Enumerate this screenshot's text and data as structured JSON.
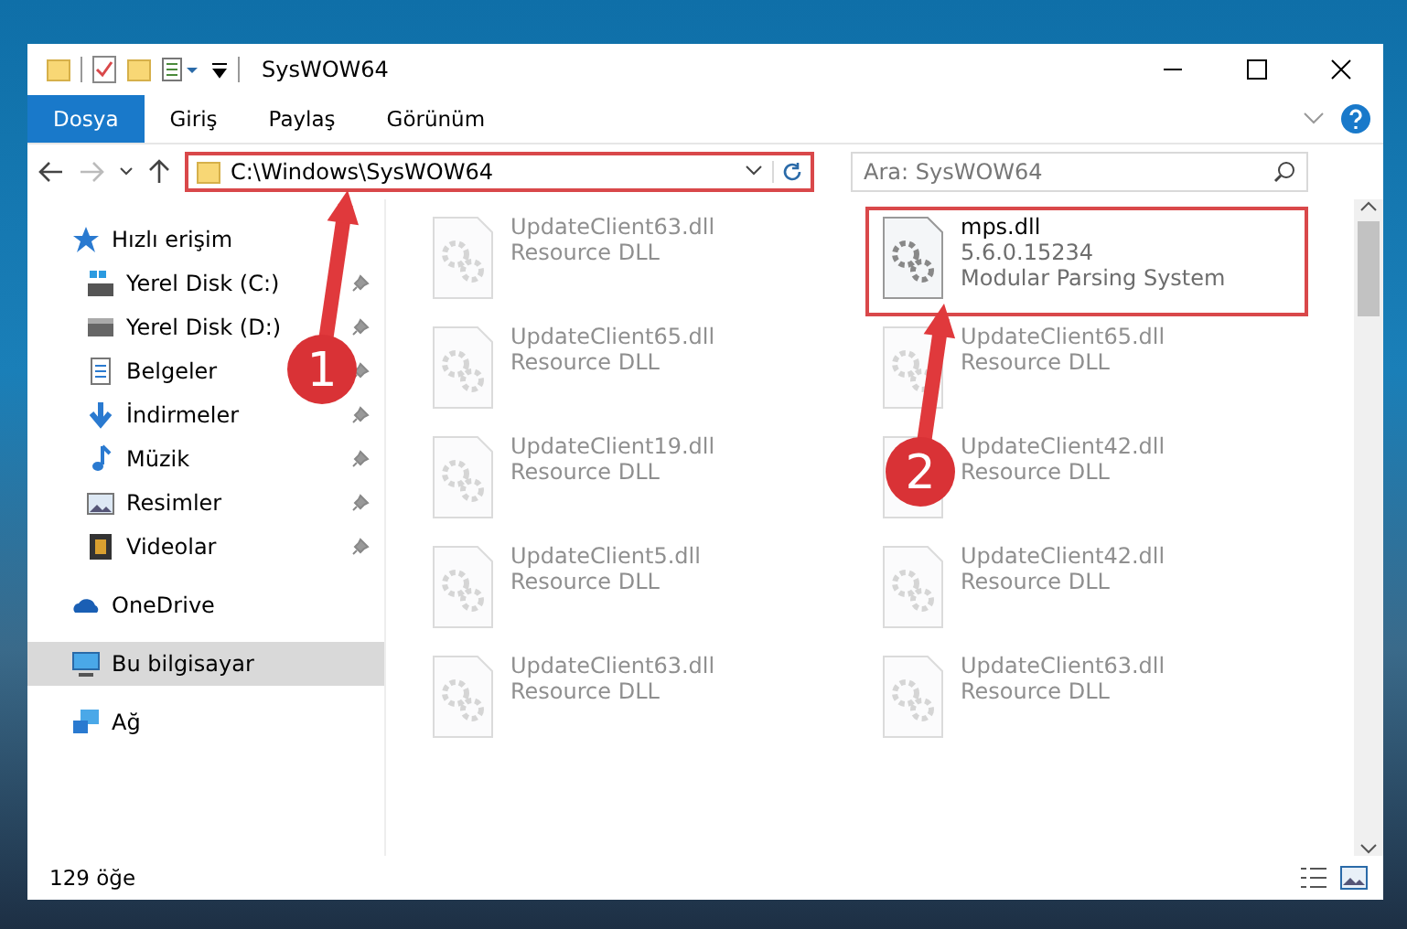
{
  "window": {
    "title": "SysWOW64"
  },
  "ribbon_tabs": [
    {
      "label": "Dosya",
      "selected": true
    },
    {
      "label": "Giriş",
      "selected": false
    },
    {
      "label": "Paylaş",
      "selected": false
    },
    {
      "label": "Görünüm",
      "selected": false
    }
  ],
  "address_bar": {
    "path": "C:\\Windows\\SysWOW64",
    "highlighted": true
  },
  "search": {
    "placeholder": "Ara: SysWOW64"
  },
  "sidebar": {
    "items": [
      {
        "label": "Hızlı erişim",
        "kind": "star",
        "selected": false,
        "pinned": false,
        "children": [
          {
            "label": "Yerel Disk (C:)",
            "kind": "drive-c",
            "selected": false,
            "pinned": true
          },
          {
            "label": "Yerel Disk (D:)",
            "kind": "drive",
            "selected": false,
            "pinned": true
          },
          {
            "label": "Belgeler",
            "kind": "document",
            "selected": false,
            "pinned": true
          },
          {
            "label": "İndirmeler",
            "kind": "download",
            "selected": false,
            "pinned": true
          },
          {
            "label": "Müzik",
            "kind": "music",
            "selected": false,
            "pinned": true
          },
          {
            "label": "Resimler",
            "kind": "pictures",
            "selected": false,
            "pinned": true
          },
          {
            "label": "Videolar",
            "kind": "video",
            "selected": false,
            "pinned": true
          }
        ]
      },
      {
        "label": "OneDrive",
        "kind": "cloud",
        "selected": false,
        "pinned": false
      },
      {
        "label": "Bu bilgisayar",
        "kind": "computer",
        "selected": true,
        "pinned": false
      },
      {
        "label": "Ağ",
        "kind": "network",
        "selected": false,
        "pinned": false
      }
    ]
  },
  "files": [
    {
      "name": "UpdateClient63.dll",
      "lines": [
        "Resource DLL"
      ],
      "faded": true,
      "highlighted": false
    },
    {
      "name": "mps.dll",
      "lines": [
        "5.6.0.15234",
        "Modular Parsing System"
      ],
      "faded": false,
      "highlighted": true
    },
    {
      "name": "UpdateClient65.dll",
      "lines": [
        "Resource DLL"
      ],
      "faded": true,
      "highlighted": false
    },
    {
      "name": "UpdateClient65.dll",
      "lines": [
        "Resource DLL"
      ],
      "faded": true,
      "highlighted": false
    },
    {
      "name": "UpdateClient19.dll",
      "lines": [
        "Resource DLL"
      ],
      "faded": true,
      "highlighted": false
    },
    {
      "name": "UpdateClient42.dll",
      "lines": [
        "Resource DLL"
      ],
      "faded": true,
      "highlighted": false
    },
    {
      "name": "UpdateClient5.dll",
      "lines": [
        "Resource DLL"
      ],
      "faded": true,
      "highlighted": false
    },
    {
      "name": "UpdateClient42.dll",
      "lines": [
        "Resource DLL"
      ],
      "faded": true,
      "highlighted": false
    },
    {
      "name": "UpdateClient63.dll",
      "lines": [
        "Resource DLL"
      ],
      "faded": true,
      "highlighted": false
    },
    {
      "name": "UpdateClient63.dll",
      "lines": [
        "Resource DLL"
      ],
      "faded": true,
      "highlighted": false
    }
  ],
  "status_bar": {
    "item_count": "129 öğe"
  },
  "callouts": [
    {
      "number": "1"
    },
    {
      "number": "2"
    }
  ]
}
